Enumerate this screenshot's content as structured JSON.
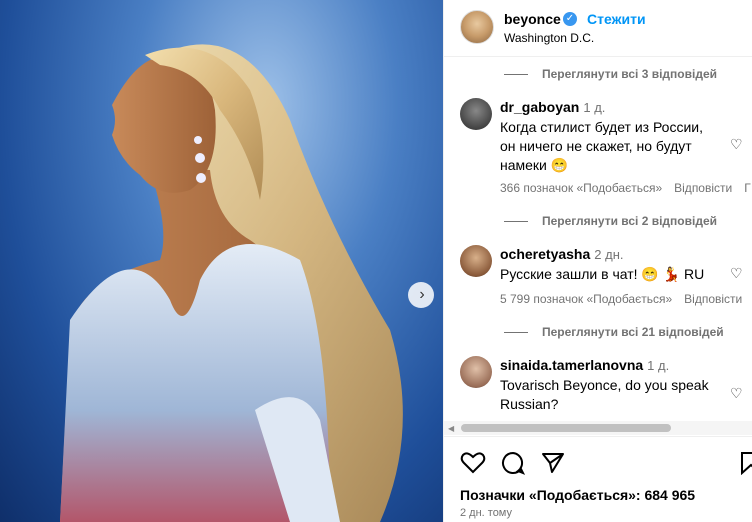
{
  "post": {
    "username": "beyonce",
    "follow_label": "Стежити",
    "location": "Washington D.C.",
    "likes_text": "Позначки «Подобається»: 684 965",
    "time_ago": "2 дн. тому"
  },
  "comments": [
    {
      "view_replies": "Переглянути всі 3 відповідей"
    },
    {
      "username": "dr_gaboyan",
      "time": "1 д.",
      "text": "Когда стилист будет из России, он ничего не скажет, но будут намеки 😁",
      "likes": "366 позначок «Подобається»",
      "reply": "Відповісти",
      "view_replies": "Переглянути всі 2 відповідей"
    },
    {
      "username": "ocheretyasha",
      "time": "2 дн.",
      "text": "Русские зашли в чат! 😁 💃 RU",
      "likes": "5 799 позначок «Подобається»",
      "reply": "Відповісти",
      "view_replies": "Переглянути всі 21 відповідей"
    },
    {
      "username": "sinaida.tamerlanovna",
      "time": "1 д.",
      "text": "Tovarisch Beyonce, do you speak Russian?"
    }
  ],
  "icons": {
    "next": "chevron-right-icon",
    "verified": "verified-badge-icon",
    "heart": "heart-icon",
    "comment": "comment-icon",
    "share": "share-icon",
    "save": "bookmark-icon"
  },
  "colors": {
    "accent": "#0095f6",
    "muted": "#737373"
  }
}
